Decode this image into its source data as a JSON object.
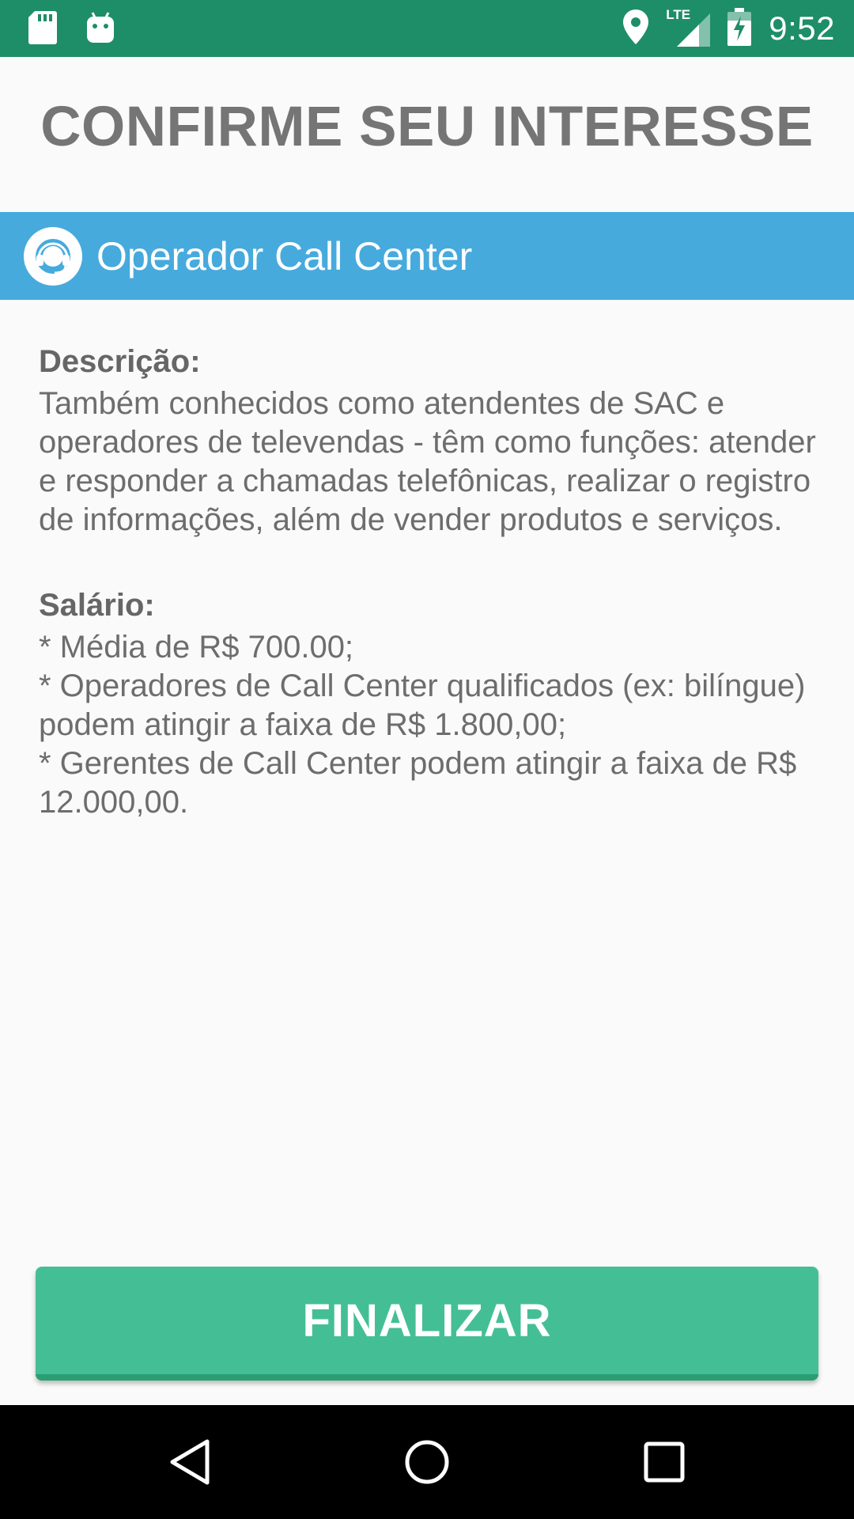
{
  "status_bar": {
    "time": "9:52",
    "network": "LTE",
    "icons": [
      "sd-card-icon",
      "android-icon",
      "location-icon",
      "signal-icon",
      "battery-icon"
    ]
  },
  "page": {
    "title": "CONFIRME SEU INTERESSE"
  },
  "job": {
    "title": "Operador Call Center",
    "icon": "headset-icon",
    "band_color": "#47aadc"
  },
  "description": {
    "label": "Descrição:",
    "text": "Também conhecidos como atendentes de SAC e operadores de televendas - têm como funções: atender e responder a chamadas telefônicas, realizar o registro de informações, além de vender produtos e serviços."
  },
  "salary": {
    "label": "Salário:",
    "lines": [
      "* Média de R$ 700.00;",
      "* Operadores de Call Center qualificados (ex: bilíngue) podem atingir a faixa de R$ 1.800,00;",
      "* Gerentes de Call Center podem atingir a faixa de R$ 12.000,00."
    ]
  },
  "actions": {
    "finalize_label": "FINALIZAR",
    "button_color": "#44bf95"
  },
  "nav_bar": {
    "buttons": [
      "back-icon",
      "home-icon",
      "recents-icon"
    ]
  },
  "colors": {
    "status_bar": "#1e8e68",
    "title_text": "#757575",
    "body_text": "#6d6d6d"
  }
}
